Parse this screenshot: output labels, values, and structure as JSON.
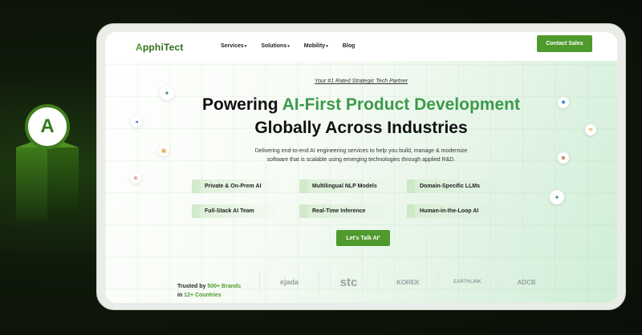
{
  "brand": {
    "logo_letter": "A",
    "name_a": "A",
    "name_rest": "pphiTect"
  },
  "nav": {
    "items": [
      {
        "label": "Services",
        "caret": "▾"
      },
      {
        "label": "Solutions",
        "caret": "▾"
      },
      {
        "label": "Mobility",
        "caret": "▾"
      },
      {
        "label": "Blog",
        "caret": ""
      }
    ],
    "contact_label": "Contact Sales"
  },
  "hero": {
    "tagline": "Your #1 Rated Strategic Tech Partner",
    "headline_pre": "Powering ",
    "headline_highlight": "AI-First Product Development",
    "headline_line2": "Globally Across Industries",
    "sub_line1": "Delivering end-to-end AI engineering services to help you build, manage & modernize",
    "sub_line2": "software that is scalable using emerging technologies through applied R&D.",
    "features": [
      "Private & On-Prem AI",
      "Multilingual NLP Models",
      "Domain-Specific LLMs",
      "Full-Stack AI Team",
      "Real-Time Inference",
      "Human-in-the-Loop AI"
    ],
    "cta_label": "Let's Talk AI",
    "cta_sup": "*"
  },
  "trusted": {
    "prefix": "Trusted by ",
    "count": "500+ Brands",
    "line2_prefix": "in ",
    "countries": "12+ Countries",
    "logos": [
      "ejada",
      "stc",
      "KOREK",
      "EARTHLINK",
      "ADCB"
    ]
  },
  "colors": {
    "accent": "#4f9a2c",
    "highlight": "#3c9a4a"
  },
  "icons": [
    "sparkle-icon",
    "code-icon",
    "box-icon",
    "asterisk-icon",
    "gear-icon",
    "stack-icon",
    "cup-icon"
  ]
}
